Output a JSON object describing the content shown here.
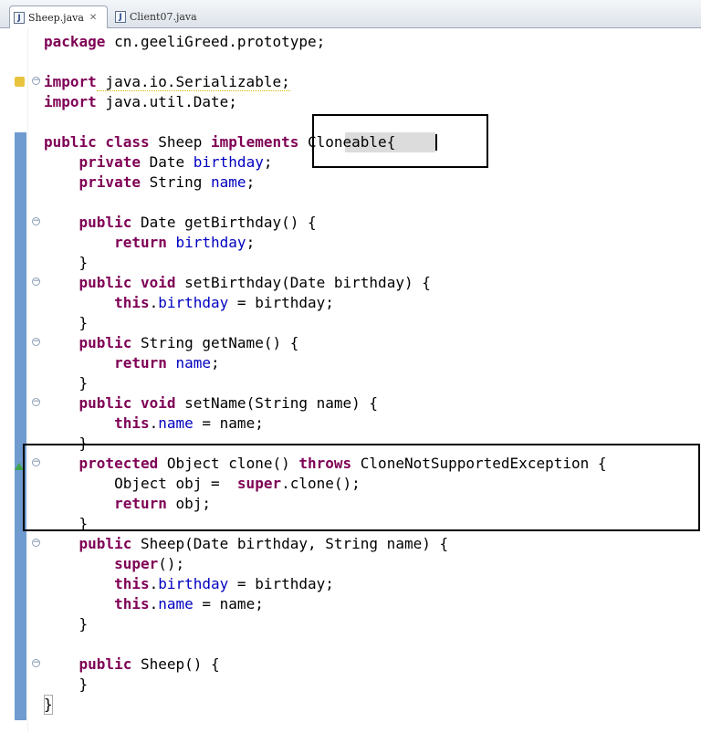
{
  "tabs": [
    {
      "label": "Sheep.java",
      "active": true,
      "closable": true
    },
    {
      "label": "Client07.java",
      "active": false,
      "closable": false
    }
  ],
  "code": {
    "l1": [
      "package cn.geeliGreed.prototype;"
    ],
    "l2a": "import",
    "l2b": " java.io.Serializable;",
    "l3a": "import",
    "l3b": " java.util.Date;",
    "l4a": "public class",
    "l4b": " Sheep ",
    "l4c": "implements",
    "l4d": " Cloneable{",
    "l5a": "    private",
    "l5b": " Date ",
    "l5c": "birthday",
    "l5d": ";",
    "l6a": "    private",
    "l6b": " String ",
    "l6c": "name",
    "l6d": ";",
    "l7a": "    public",
    "l7b": " Date getBirthday() {",
    "l8a": "        return",
    "l8b": " ",
    "l8c": "birthday",
    "l8d": ";",
    "l9": "    }",
    "l10a": "    public void",
    "l10b": " setBirthday(Date birthday) {",
    "l11a": "        this",
    "l11b": ".",
    "l11c": "birthday",
    "l11d": " = birthday;",
    "l12": "    }",
    "l13a": "    public",
    "l13b": " String getName() {",
    "l14a": "        return",
    "l14b": " ",
    "l14c": "name",
    "l14d": ";",
    "l15": "    }",
    "l16a": "    public void",
    "l16b": " setName(String name) {",
    "l17a": "        this",
    "l17b": ".",
    "l17c": "name",
    "l17d": " = name;",
    "l18": "    }",
    "l19a": "    protected",
    "l19b": " Object clone() ",
    "l19c": "throws",
    "l19d": " CloneNotSupportedException {",
    "l20a": "        Object obj =  ",
    "l20b": "super",
    "l20c": ".clone();",
    "l21a": "        return",
    "l21b": " obj;",
    "l22": "    }",
    "l23a": "    public",
    "l23b": " Sheep(Date birthday, String name) {",
    "l24a": "        super",
    "l24b": "();",
    "l25a": "        this",
    "l25b": ".",
    "l25c": "birthday",
    "l25d": " = birthday;",
    "l26a": "        this",
    "l26b": ".",
    "l26c": "name",
    "l26d": " = name;",
    "l27": "    }",
    "l28a": "    public",
    "l28b": " Sheep() {",
    "l29": "    }",
    "l30": "}"
  },
  "package_kw": "package",
  "package_rest": " cn.geeliGreed.prototype;"
}
